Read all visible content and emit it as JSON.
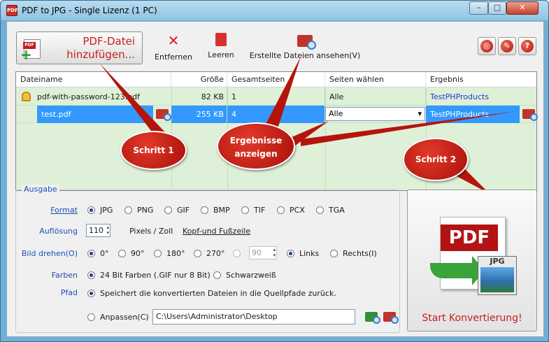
{
  "window": {
    "title": "PDF to JPG - Single Lizenz (1 PC)",
    "app_icon": "PDF"
  },
  "toolbar": {
    "add_label_1": "PDF-Datei",
    "add_label_2": "hinzufügen...",
    "remove": "Entfernen",
    "clear": "Leeren",
    "view_output": "Erstellte Dateien ansehen(V)"
  },
  "grid": {
    "headers": [
      "Dateiname",
      "Größe",
      "Gesamtseiten",
      "Seiten wählen",
      "Ergebnis"
    ],
    "rows": [
      {
        "name": "pdf-with-password-123.pdf",
        "size": "82 KB",
        "pages": "1",
        "select": "Alle",
        "result": "TestPHProducts"
      },
      {
        "name": "test.pdf",
        "size": "255 KB",
        "pages": "4",
        "select": "Alle",
        "result": "TestPHProducts"
      }
    ]
  },
  "callouts": {
    "step1": "Schritt 1",
    "results_1": "Ergebnisse",
    "results_2": "anzeigen",
    "step2": "Schritt 2"
  },
  "output": {
    "legend": "Ausgabe",
    "format_label": "Format",
    "formats": [
      "JPG",
      "PNG",
      "GIF",
      "BMP",
      "TIF",
      "PCX",
      "TGA"
    ],
    "resolution_label": "Auflösung",
    "resolution_value": "110",
    "resolution_unit": "Pixels / Zoll",
    "header_footer": "Kopf-und Fußzeile",
    "rotate_label": "Bild drehen(O)",
    "rotations": [
      "0°",
      "90°",
      "180°",
      "270°"
    ],
    "custom_angle": "90",
    "direction_left": "Links",
    "direction_right": "Rechts(I)",
    "colors_label": "Farben",
    "color_24": "24 Bit Farben (.GIF nur 8 Bit)",
    "color_bw": "Schwarzweiß",
    "path_label": "Pfad",
    "path_source": "Speichert die konvertierten Dateien in die Quellpfade zurück.",
    "path_custom": "Anpassen(C)",
    "path_value": "C:\\Users\\Administrator\\Desktop"
  },
  "convert": {
    "label": "Start Konvertierung!",
    "pdf_text": "PDF",
    "jpg_text": "JPG"
  }
}
